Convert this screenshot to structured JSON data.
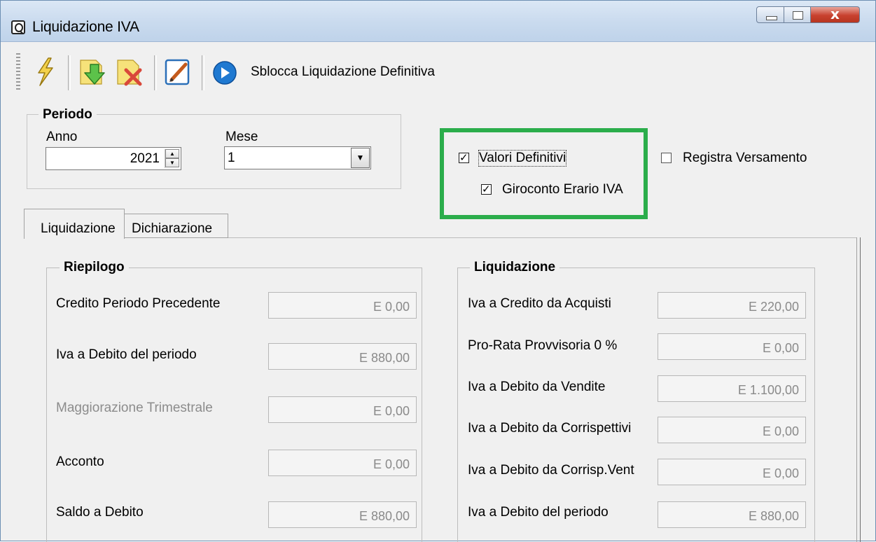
{
  "window": {
    "title": "Liquidazione IVA",
    "controls": {
      "close": "x"
    }
  },
  "toolbar": {
    "icons": [
      "lightning-icon",
      "download-icon",
      "delete-icon",
      "edit-icon",
      "play-icon"
    ],
    "unlock_label": "Sblocca Liquidazione Definitiva"
  },
  "periodo": {
    "title": "Periodo",
    "anno_label": "Anno",
    "anno_value": "2021",
    "mese_label": "Mese",
    "mese_value": "1"
  },
  "options": {
    "valori_definitivi": {
      "label": "Valori Definitivi",
      "checked": true
    },
    "giroconto": {
      "label": "Giroconto Erario IVA",
      "checked": true
    },
    "registra_versamento": {
      "label": "Registra Versamento",
      "checked": false
    },
    "highlight_color": "#2bad4b",
    "check_mark": "✓"
  },
  "tabs": [
    {
      "label": "Liquidazione",
      "active": true
    },
    {
      "label": "Dichiarazione",
      "active": false
    }
  ],
  "riepilogo": {
    "title": "Riepilogo",
    "rows": [
      {
        "label": "Credito Periodo Precedente",
        "value": "E 0,00",
        "enabled": true
      },
      {
        "label": "Iva a Debito del periodo",
        "value": "E 880,00",
        "enabled": true
      },
      {
        "label": "Maggiorazione Trimestrale",
        "value": "E 0,00",
        "enabled": false
      },
      {
        "label": "Acconto",
        "value": "E 0,00",
        "enabled": true
      },
      {
        "label": "Saldo a Debito",
        "value": "E 880,00",
        "enabled": true
      }
    ]
  },
  "liquidazione": {
    "title": "Liquidazione",
    "rows": [
      {
        "label": "Iva a Credito da Acquisti",
        "value": "E 220,00"
      },
      {
        "label": "Pro-Rata Provvisoria 0 %",
        "value": "E 0,00"
      },
      {
        "label": "Iva a Debito da Vendite",
        "value": "E 1.100,00"
      },
      {
        "label": "Iva a Debito da Corrispettivi",
        "value": "E 0,00"
      },
      {
        "label": "Iva a Debito da Corrisp.Vent",
        "value": "E 0,00"
      },
      {
        "label": "Iva a Debito del periodo",
        "value": "E 880,00"
      }
    ]
  }
}
